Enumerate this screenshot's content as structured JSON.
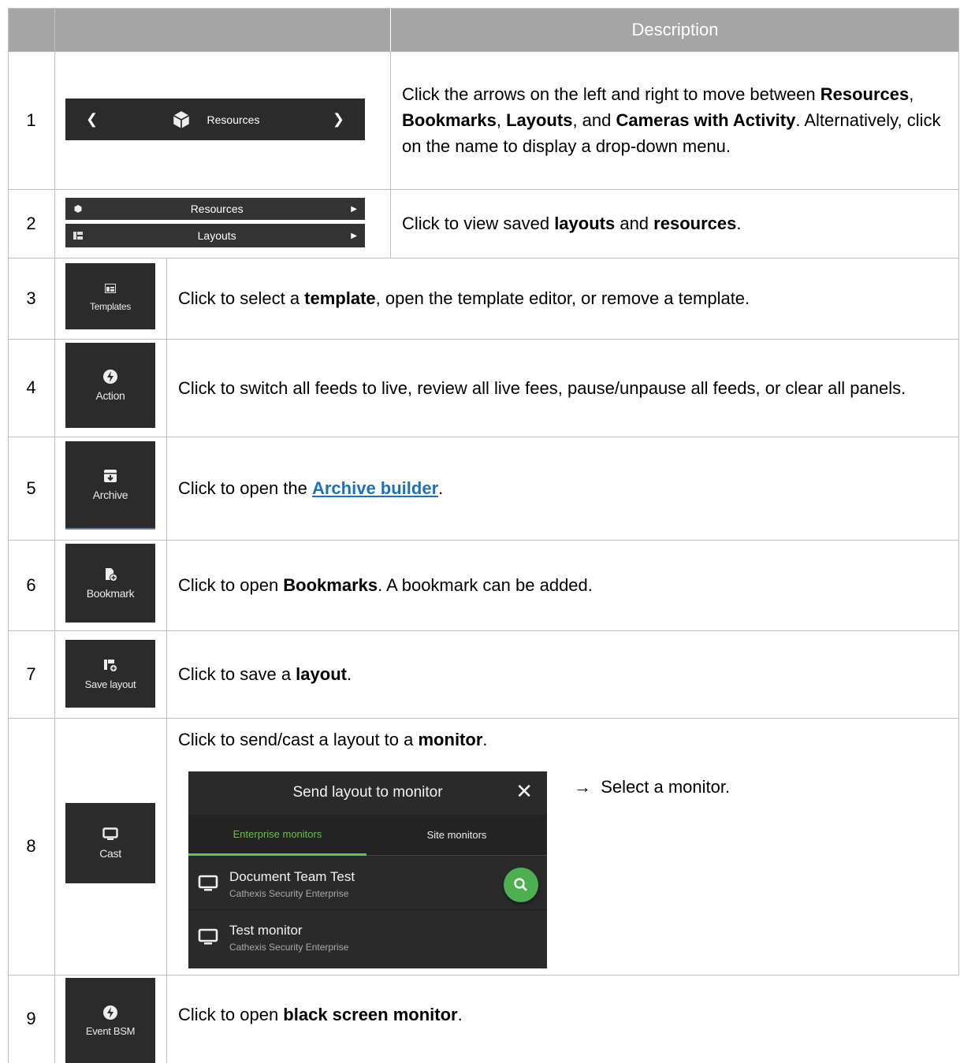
{
  "header": {
    "description": "Description"
  },
  "rows": [
    {
      "num": "1",
      "widget": {
        "label": "Resources"
      },
      "desc_pre": "Click the arrows on the left and right to move between ",
      "b1": "Resources",
      "s1": ", ",
      "b2": "Bookmarks",
      "s2": ", ",
      "b3": "Layouts",
      "s3": ", and ",
      "b4": "Cameras with Activity",
      "desc_post": ". Alternatively, click on the name to display a drop-down menu."
    },
    {
      "num": "2",
      "widget": {
        "item1": "Resources",
        "item2": "Layouts"
      },
      "desc_pre": "Click to view saved ",
      "b1": "layouts",
      "s1": " and ",
      "b2": "resources",
      "desc_post": "."
    },
    {
      "num": "3",
      "tile": "Templates",
      "desc_pre": "Click to select a ",
      "b1": "template",
      "desc_post": ", open the template editor, or remove a template."
    },
    {
      "num": "4",
      "tile": "Action",
      "desc": "Click to switch all feeds to live, review all live fees, pause/unpause all feeds, or clear all panels."
    },
    {
      "num": "5",
      "tile": "Archive",
      "desc_pre": "Click to open the ",
      "link": "Archive builder",
      "desc_post": "."
    },
    {
      "num": "6",
      "tile": "Bookmark",
      "desc_pre": "Click to open ",
      "b1": "Bookmarks",
      "desc_post": ". A bookmark can be added."
    },
    {
      "num": "7",
      "tile": "Save layout",
      "desc_pre": "Click to save a ",
      "b1": "layout",
      "desc_post": "."
    },
    {
      "num": "8",
      "tile": "Cast",
      "desc_pre": "Click to send/cast a layout to a ",
      "b1": "monitor",
      "desc_post": ".",
      "dialog": {
        "title": "Send layout to monitor",
        "tab_enterprise": "Enterprise monitors",
        "tab_site": "Site monitors",
        "monitors": [
          {
            "name": "Document Team Test",
            "sub": "Cathexis Security Enterprise"
          },
          {
            "name": "Test monitor",
            "sub": "Cathexis Security Enterprise"
          }
        ],
        "note": "→  Select a monitor."
      }
    },
    {
      "num": "9",
      "tile": "Event BSM",
      "desc_pre": "Click to open ",
      "b1": "black screen monitor",
      "desc_post": "."
    }
  ],
  "colors": {
    "header_bg": "#a5a5a5",
    "widget_bg": "#2b2b2b",
    "accent_green": "#4caf50",
    "link": "#1f6fbf"
  }
}
